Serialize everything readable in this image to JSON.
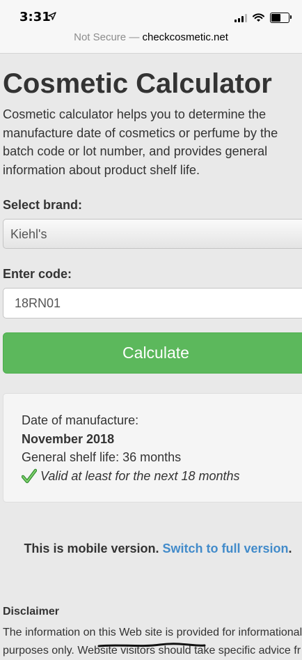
{
  "status_bar": {
    "time": "3:31",
    "location_icon": "location-arrow-icon",
    "signal_icon": "cellular-signal-icon",
    "wifi_icon": "wifi-icon",
    "battery_icon": "battery-icon"
  },
  "url_bar": {
    "security_label": "Not Secure",
    "separator": "—",
    "domain": "checkcosmetic.net"
  },
  "page": {
    "title": "Cosmetic Calculator",
    "intro": "Cosmetic calculator helps you to determine the manufacture date of cosmetics or perfume by the batch code or lot number, and provides general information about product shelf life."
  },
  "form": {
    "brand_label": "Select brand:",
    "brand_value": "Kiehl's",
    "code_label": "Enter code:",
    "code_value": "18RN01",
    "calculate_label": "Calculate"
  },
  "result": {
    "manufacture_label": "Date of manufacture:",
    "manufacture_date": "November 2018",
    "shelf_life": "General shelf life: 36 months",
    "validity": "Valid at least for the next 18 months",
    "check_icon": "checkmark-icon"
  },
  "mobile_note": {
    "text": "This is mobile version.",
    "link": "Switch to full version",
    "period": "."
  },
  "disclaimer": {
    "title": "Disclaimer",
    "line1": "The information on this Web site is provided for informational",
    "line2": "purposes only. Website visitors should take specific advice fr"
  },
  "colors": {
    "calculate_button": "#5cb85c",
    "link": "#428bca",
    "background": "#e9e9e9"
  }
}
